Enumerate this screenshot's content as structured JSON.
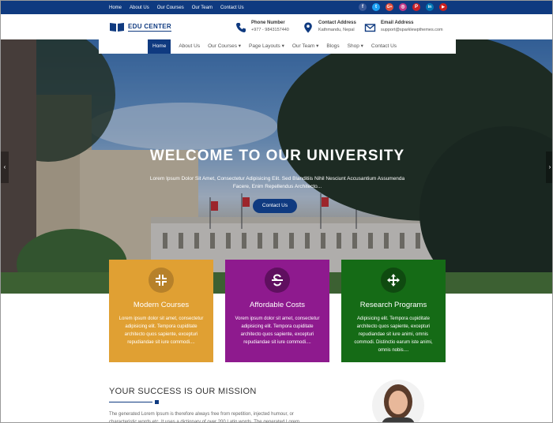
{
  "topbar": {
    "links": [
      "Home",
      "About Us",
      "Our Courses",
      "Our Team",
      "Contact Us"
    ],
    "social": [
      {
        "icon": "facebook-icon",
        "glyph": "f",
        "color": "#3b5998"
      },
      {
        "icon": "twitter-icon",
        "glyph": "t",
        "color": "#1da1f2"
      },
      {
        "icon": "google-plus-icon",
        "glyph": "G+",
        "color": "#dd4b39"
      },
      {
        "icon": "instagram-icon",
        "glyph": "◎",
        "color": "#c13584"
      },
      {
        "icon": "pinterest-icon",
        "glyph": "P",
        "color": "#cb2027"
      },
      {
        "icon": "linkedin-icon",
        "glyph": "in",
        "color": "#0077b5"
      },
      {
        "icon": "youtube-icon",
        "glyph": "▶",
        "color": "#cd201f"
      }
    ]
  },
  "header": {
    "logo_text": "EDU CENTER",
    "phone": {
      "title": "Phone Number",
      "value": "+977 - 9843157440"
    },
    "address": {
      "title": "Contact Address",
      "value": "Kathmandu, Nepal"
    },
    "email": {
      "title": "Email Address",
      "value": "support@sparklewpthemes.com"
    }
  },
  "nav": {
    "items": [
      "Home",
      "About Us",
      "Our Courses",
      "Page Layouts",
      "Our Team",
      "Blogs",
      "Shop",
      "Contact Us"
    ],
    "dropdowns": [
      "",
      "",
      "▾",
      "▾",
      "▾",
      "",
      "▾",
      ""
    ],
    "active_index": 0
  },
  "hero": {
    "title": "WELCOME TO OUR UNIVERSITY",
    "subtitle": "Lorem Ipsum Dolor Sit Amet, Consectetur Adipisicing Elit. Sed Blanditiis Nihil Nesciunt Accusantium Assumenda Facere, Enim Repellendus Architecto...",
    "button": "Contact Us",
    "prev": "‹",
    "next": "›"
  },
  "features": [
    {
      "title": "Modern Courses",
      "desc": "Lorem ipsum dolor sit amet, consectetur adipisicing elit. Tempora cupiditate architecto quos sapiente, excepturi repudiandae sit iure commodi....",
      "color": "#e0a033",
      "icon": "compress-arrows-icon"
    },
    {
      "title": "Affordable Costs",
      "desc": "Vorem ipsum dolor sit amet, consectetur adipisicing elit. Tempora cupiditate architecto quos sapiente, excepturi repudiandae sit iure commodi....",
      "color": "#8e1a8e",
      "icon": "strikethrough-icon"
    },
    {
      "title": "Research Programs",
      "desc": "Adipisicing elit. Tempora cupiditate architecto quos sapiente, excepturi repudiandae sit iure animi, omnis commodi. Distinctio earum iste animi, omnis nobis....",
      "color": "#156b16",
      "icon": "move-arrows-icon"
    }
  ],
  "mission": {
    "title": "YOUR SUCCESS IS OUR MISSION",
    "text": "The generated Lorem Ipsum is therefore always free from repetition, injected humour, or characteristic words etc. It uses a dictionary of over 200 Latin words. The generated Lorem"
  }
}
